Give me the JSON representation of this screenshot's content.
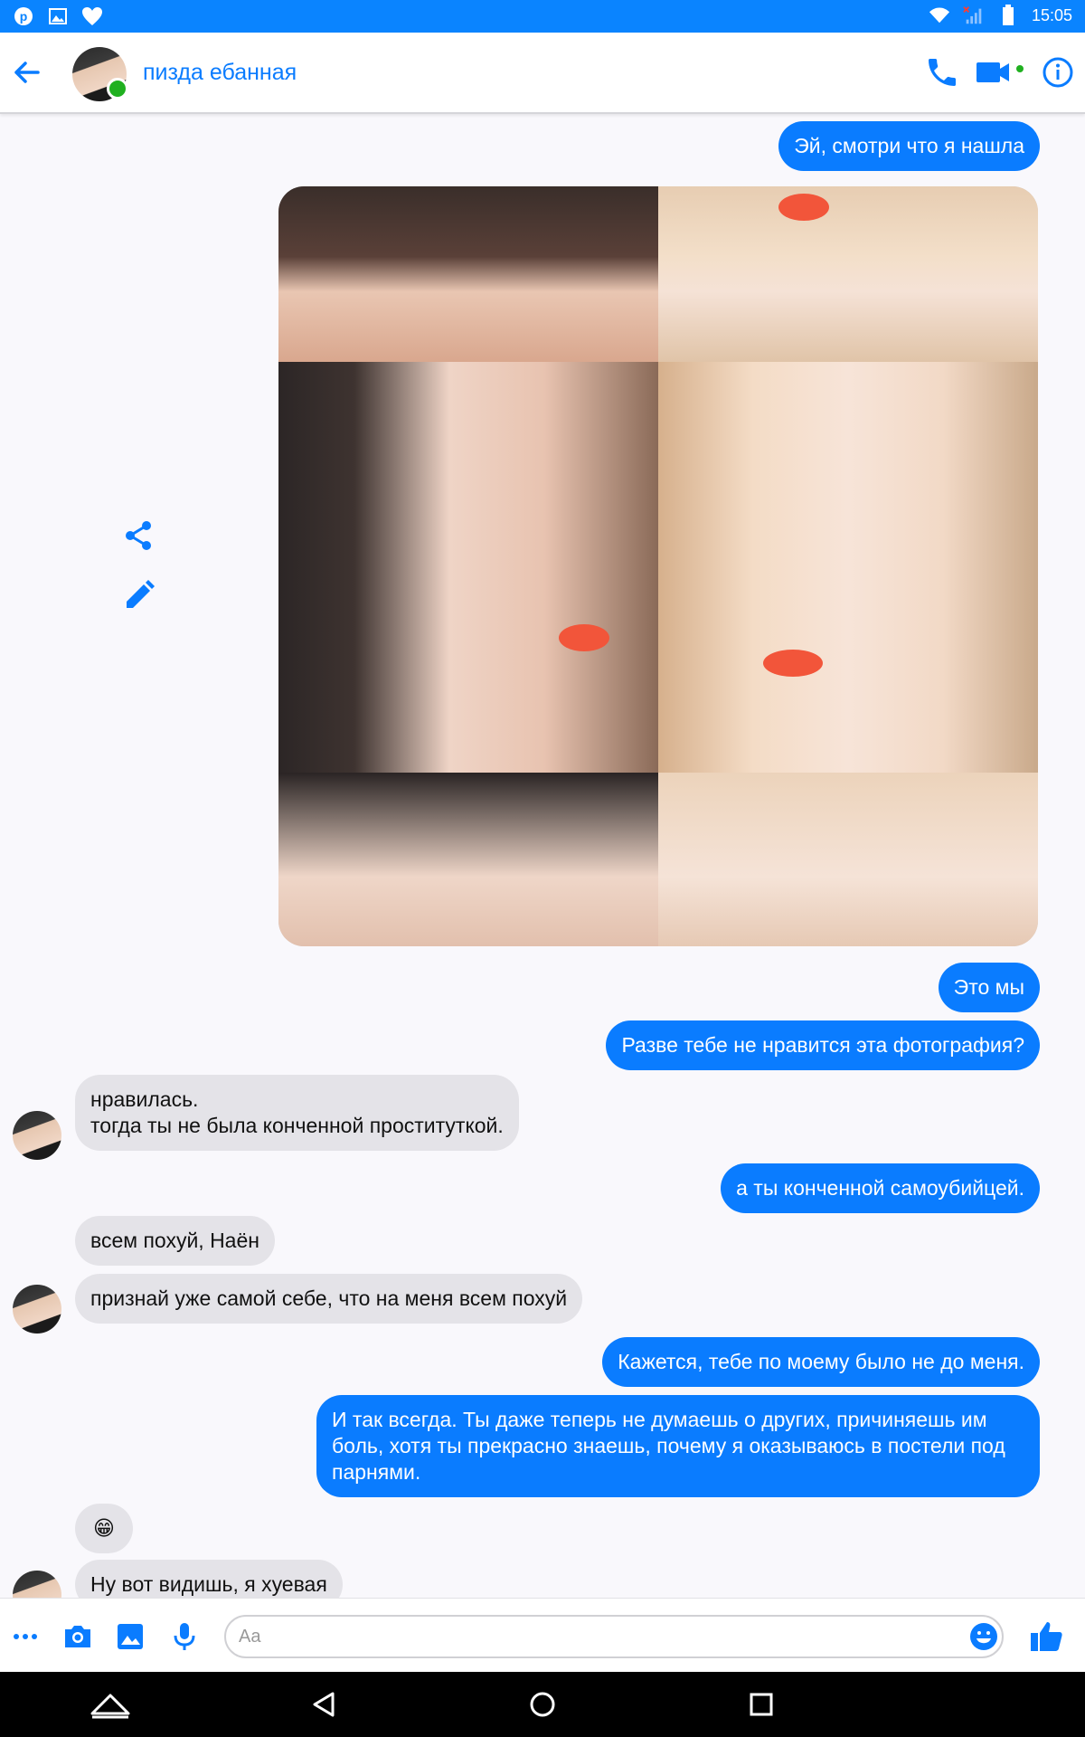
{
  "status_bar": {
    "time": "15:05",
    "icons": [
      "pinterest-icon",
      "gallery-icon",
      "heart-icon",
      "wifi-icon",
      "signal-icon",
      "battery-icon"
    ]
  },
  "header": {
    "contact_name": "пизда ебанная",
    "icons": [
      "back-arrow-icon",
      "phone-icon",
      "video-icon",
      "info-icon"
    ]
  },
  "messages": [
    {
      "side": "out",
      "text": "Эй, смотри что я нашла"
    },
    {
      "side": "out",
      "type": "photo"
    },
    {
      "side": "out",
      "text": "Это мы"
    },
    {
      "side": "out",
      "text": "Разве тебе не нравится эта фотография?"
    },
    {
      "side": "in",
      "text": "нравилась.\nтогда ты не была конченной проституткой."
    },
    {
      "side": "out",
      "text": "а ты конченной самоубийцей."
    },
    {
      "side": "in",
      "text": "всем похуй, Наён"
    },
    {
      "side": "in",
      "text": "признай уже самой себе, что на меня всем похуй"
    },
    {
      "side": "out",
      "text": "Кажется, тебе по моему было не до меня."
    },
    {
      "side": "out",
      "text": "И так всегда. Ты даже теперь не думаешь о других, причиняешь им боль, хотя ты прекрасно знаешь, почему я оказываюсь в постели под парнями."
    },
    {
      "side": "in",
      "text": "😁"
    },
    {
      "side": "in",
      "text": "Ну вот видишь, я хуевая"
    }
  ],
  "composer": {
    "placeholder": "Aa",
    "icons": [
      "more-icon",
      "camera-icon",
      "image-icon",
      "mic-icon",
      "emoji-icon",
      "like-icon"
    ]
  },
  "colors": {
    "accent": "#0a7cff",
    "status_bar": "#0a84ff",
    "incoming": "#e4e3e8"
  }
}
